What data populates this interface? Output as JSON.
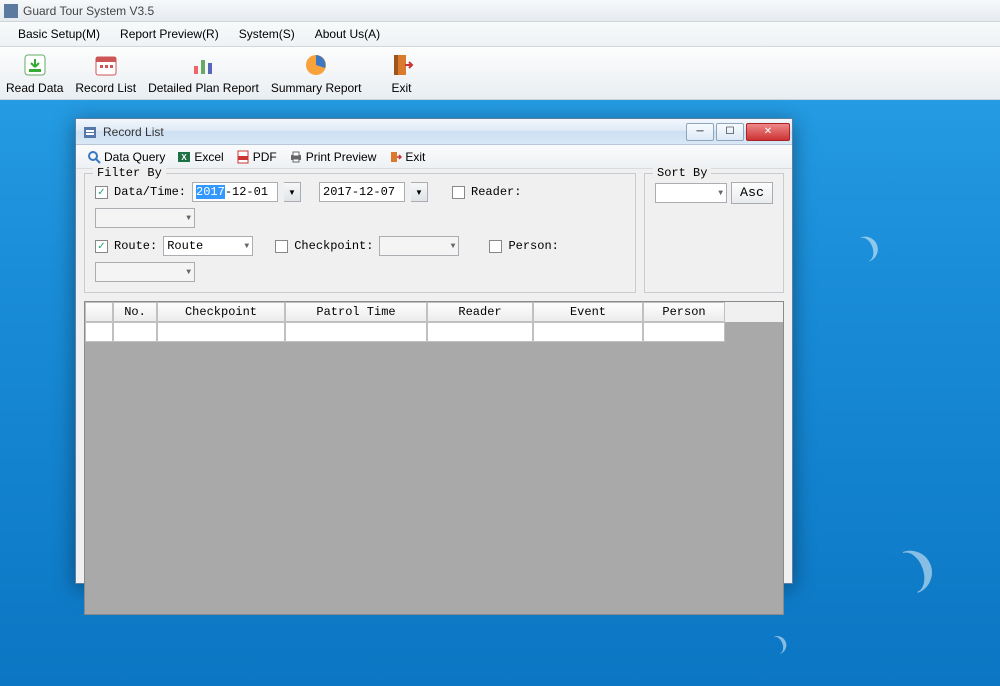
{
  "app": {
    "title": "Guard Tour System V3.5",
    "menus": [
      "Basic Setup(M)",
      "Report Preview(R)",
      "System(S)",
      "About Us(A)"
    ],
    "toolbar": [
      {
        "label": "Read Data",
        "icon": "download"
      },
      {
        "label": "Record List",
        "icon": "calendar"
      },
      {
        "label": "Detailed Plan Report",
        "icon": "bar-chart"
      },
      {
        "label": "Summary Report",
        "icon": "pie-chart"
      },
      {
        "label": "Exit",
        "icon": "door"
      }
    ]
  },
  "child": {
    "title": "Record List",
    "toolbar": [
      {
        "label": "Data Query",
        "icon": "search"
      },
      {
        "label": "Excel",
        "icon": "excel"
      },
      {
        "label": "PDF",
        "icon": "pdf"
      },
      {
        "label": "Print Preview",
        "icon": "printer"
      },
      {
        "label": "Exit",
        "icon": "door"
      }
    ],
    "filter": {
      "legend": "Filter By",
      "date_label": "Data/Time:",
      "date_from": "2017-12-01",
      "date_from_year": "2017",
      "date_from_rest": "-12-01",
      "date_to": "2017-12-07",
      "reader_label": "Reader:",
      "route_label": "Route:",
      "route_value": "Route",
      "checkpoint_label": "Checkpoint:",
      "person_label": "Person:"
    },
    "sort": {
      "legend": "Sort By",
      "asc_label": "Asc"
    },
    "grid": {
      "columns": [
        "No.",
        "Checkpoint",
        "Patrol Time",
        "Reader",
        "Event",
        "Person"
      ]
    }
  }
}
